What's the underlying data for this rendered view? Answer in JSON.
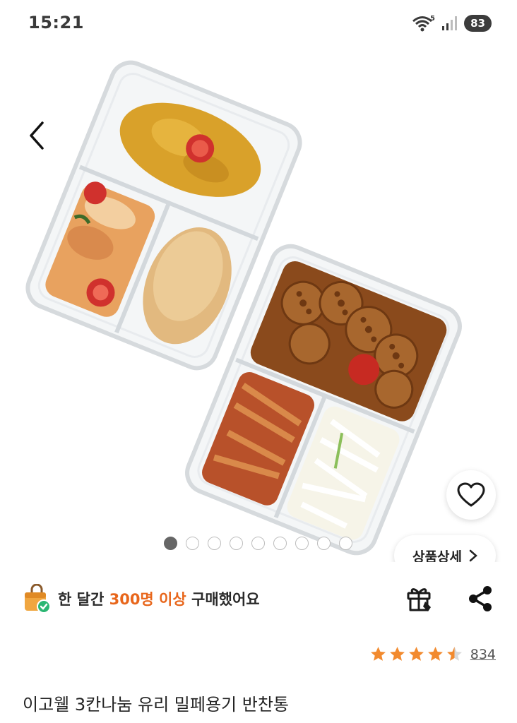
{
  "status": {
    "time": "15:21",
    "wifi_badge": "5",
    "battery": "83"
  },
  "hero": {
    "image_count": 9,
    "active_index": 0,
    "detail_button_label": "상품상세",
    "icons": {
      "back": "chevron-left-icon",
      "heart": "heart-icon",
      "detail_arrow": "chevron-right-icon"
    }
  },
  "purchase": {
    "prefix": "한 달간 ",
    "highlight": "300명 이상",
    "suffix": " 구매했어요",
    "accent_color": "#e8661b"
  },
  "actions": {
    "gift": "gift-icon",
    "share": "share-icon"
  },
  "rating": {
    "stars": 4.5,
    "count": "834",
    "star_color": "#f28a2e"
  },
  "product": {
    "title": "이고웰 3칸나눔 유리 밀페용기 반찬통"
  }
}
